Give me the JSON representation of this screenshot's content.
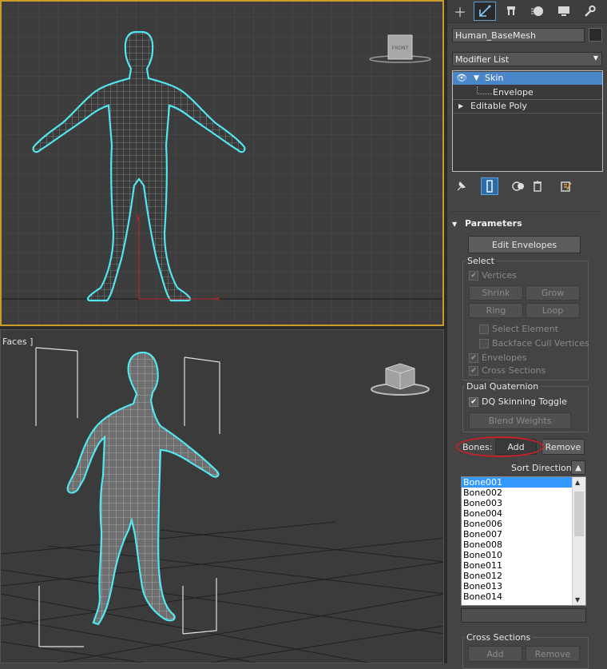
{
  "viewport_front": {
    "cube_label": "FRONT",
    "axis_x": "x",
    "axis_y": "y"
  },
  "viewport_persp": {
    "label": "Faces ]"
  },
  "command_panel": {
    "tabs": [
      "create-icon",
      "modify-icon",
      "hierarchy-icon",
      "motion-icon",
      "display-icon",
      "utilities-icon"
    ],
    "object_name": "Human_BaseMesh",
    "modifier_list": "Modifier List",
    "stack": [
      {
        "label": "Skin",
        "selected": true
      },
      {
        "label": "Envelope",
        "selected": false
      },
      {
        "label": "Editable Poly",
        "selected": false
      }
    ],
    "parameters": {
      "title": "Parameters",
      "edit_envelopes": "Edit Envelopes",
      "select": {
        "title": "Select",
        "vertices": "Vertices",
        "shrink": "Shrink",
        "grow": "Grow",
        "ring": "Ring",
        "loop": "Loop",
        "select_element": "Select Element",
        "backface_cull": "Backface Cull Vertices",
        "envelopes": "Envelopes",
        "cross_sections": "Cross Sections"
      },
      "dual_quaternion": {
        "title": "Dual Quaternion",
        "dq_toggle": "DQ Skinning Toggle",
        "blend_weights": "Blend Weights"
      },
      "bones_label": "Bones:",
      "add": "Add",
      "remove": "Remove",
      "sort_direction": "Sort Direction:",
      "bones": [
        "Bone001",
        "Bone002",
        "Bone003",
        "Bone004",
        "Bone006",
        "Bone007",
        "Bone008",
        "Bone010",
        "Bone011",
        "Bone012",
        "Bone013",
        "Bone014"
      ],
      "cross_sections": {
        "title": "Cross Sections",
        "add": "Add",
        "remove": "Remove"
      }
    }
  }
}
